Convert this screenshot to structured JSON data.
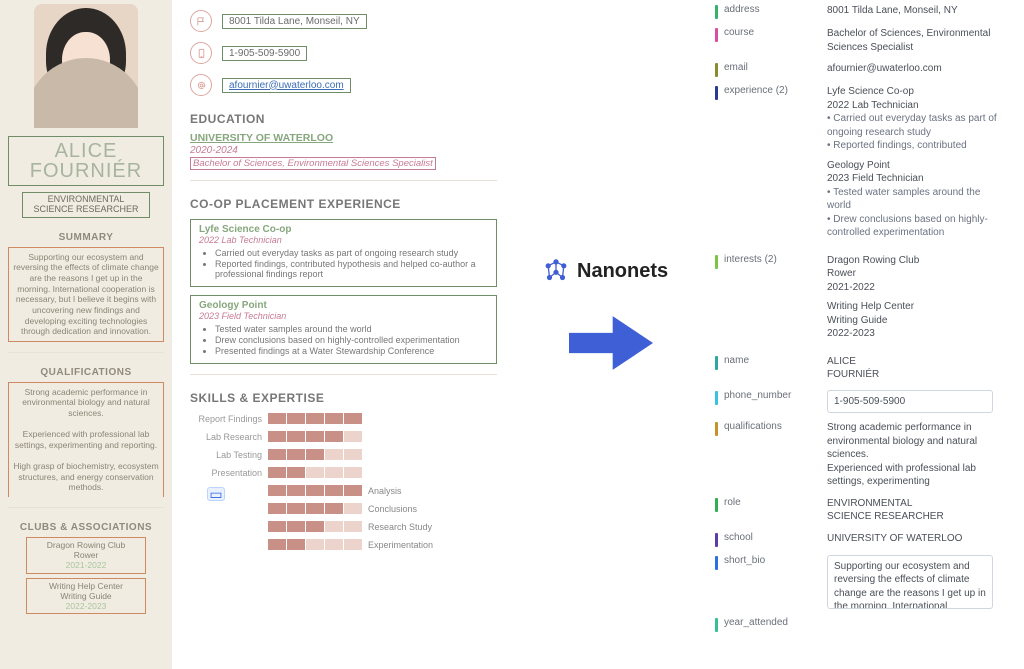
{
  "profile": {
    "first_name": "ALICE",
    "last_name": "FOURNIÉR",
    "role_line1": "ENVIRONMENTAL",
    "role_line2": "SCIENCE RESEARCHER"
  },
  "sidebar": {
    "summary_h": "SUMMARY",
    "summary": "Supporting our ecosystem and reversing the effects of climate change are the reasons I get up in the morning. International cooperation is necessary, but I believe it begins with uncovering new findings and developing exciting technologies through dedication and innovation.",
    "qual_h": "QUALIFICATIONS",
    "qual_p1": "Strong academic performance in environmental biology and natural sciences.",
    "qual_p2": "Experienced with professional lab settings, experimenting and reporting.",
    "qual_p3": "High grasp of biochemistry, ecosystem structures, and energy conservation methods.",
    "clubs_h": "CLUBS & ASSOCIATIONS",
    "club1_name": "Dragon Rowing Club",
    "club1_role": "Rower",
    "club1_years": "2021-2022",
    "club2_name": "Writing Help Center",
    "club2_role": "Writing Guide",
    "club2_years": "2022-2023"
  },
  "contact": {
    "address": "8001 Tilda Lane, Monseil, NY",
    "phone": "1-905-509-5900",
    "email": "afournier@uwaterloo.com"
  },
  "education": {
    "heading": "EDUCATION",
    "school": "UNIVERSITY OF WATERLOO",
    "years": "2020-2024",
    "degree": "Bachelor of Sciences, Environmental Sciences Specialist"
  },
  "coop": {
    "heading": "CO-OP PLACEMENT EXPERIENCE",
    "exp1_title": "Lyfe Science Co-op",
    "exp1_pos": "2022 Lab Technician",
    "exp1_b1": "Carried out everyday tasks as part of ongoing research study",
    "exp1_b2": "Reported findings, contributed hypothesis and helped co-author a professional findings report",
    "exp2_title": "Geology Point",
    "exp2_pos": "2023 Field Technician",
    "exp2_b1": "Tested water samples around the world",
    "exp2_b2": "Drew conclusions based on highly-controlled experimentation",
    "exp2_b3": "Presented findings at a Water Stewardship Conference"
  },
  "skills": {
    "heading": "SKILLS & EXPERTISE",
    "left": [
      "Report Findings",
      "Lab Research",
      "Lab Testing",
      "Presentation"
    ],
    "right": [
      "Analysis",
      "Conclusions",
      "Research Study",
      "Experimentation"
    ]
  },
  "brand": {
    "name": "Nanonets"
  },
  "extracted": {
    "address_k": "address",
    "address_v": "8001 Tilda Lane, Monseil, NY",
    "course_k": "course",
    "course_v": "Bachelor of Sciences, Environmental Sciences Specialist",
    "email_k": "email",
    "email_v": "afournier@uwaterloo.com",
    "exp_k": "experience (2)",
    "exp1_t": "Lyfe Science Co-op",
    "exp1_p": "2022 Lab Technician",
    "exp1_b1": "• Carried out everyday tasks as part of ongoing research study",
    "exp1_b2": "• Reported findings, contributed",
    "exp2_t": "Geology Point",
    "exp2_p": "2023 Field Technician",
    "exp2_b1": "• Tested water samples around the world",
    "exp2_b2": "• Drew conclusions based on highly-controlled experimentation",
    "int_k": "interests (2)",
    "int1_t": "Dragon Rowing Club",
    "int1_r": "Rower",
    "int1_y": "2021-2022",
    "int2_t": "Writing Help Center",
    "int2_r": "Writing Guide",
    "int2_y": "2022-2023",
    "name_k": "name",
    "name_v1": "ALICE",
    "name_v2": "FOURNIÉR",
    "phone_k": "phone_number",
    "phone_v": "1-905-509-5900",
    "qual_k": "qualifications",
    "qual_v1": "Strong academic performance in environmental biology and natural sciences.",
    "qual_v2": "Experienced with professional lab settings, experimenting",
    "role_k": "role",
    "role_v1": "ENVIRONMENTAL",
    "role_v2": "SCIENCE RESEARCHER",
    "school_k": "school",
    "school_v": "UNIVERSITY OF WATERLOO",
    "bio_k": "short_bio",
    "bio_v": "Supporting our ecosystem and reversing the effects of climate change are the reasons I get up in the morning. International cooperation is necessary, but I believe it begins",
    "year_k": "year_attended"
  },
  "chart_data": {
    "type": "bar",
    "title": "SKILLS & EXPERTISE",
    "series": [
      {
        "name": "left-group",
        "categories": [
          "Report Findings",
          "Lab Research",
          "Lab Testing",
          "Presentation"
        ],
        "values": [
          5,
          4,
          3,
          2
        ],
        "max": 5
      },
      {
        "name": "right-group",
        "categories": [
          "Analysis",
          "Conclusions",
          "Research Study",
          "Experimentation"
        ],
        "values": [
          5,
          4,
          3,
          2
        ],
        "max": 5
      }
    ]
  }
}
